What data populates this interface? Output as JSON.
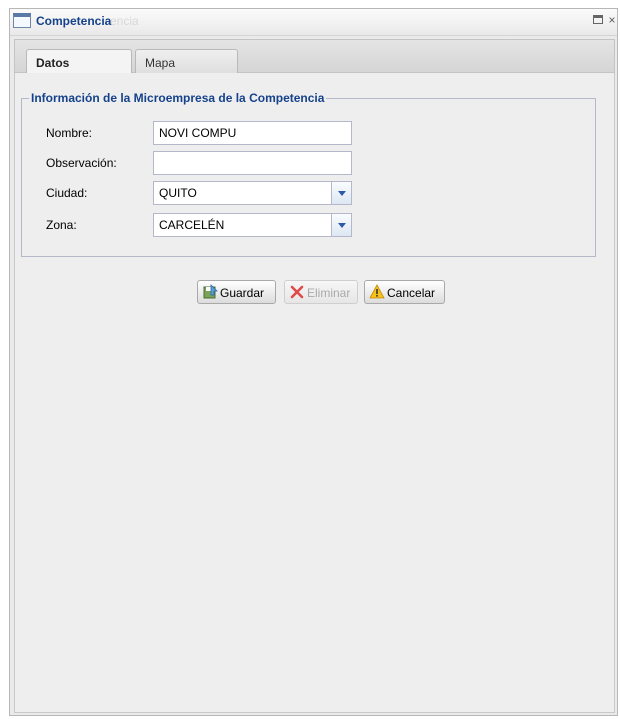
{
  "window": {
    "title": "Competencia",
    "ghost_text": "encia"
  },
  "tabs": [
    {
      "label": "Datos",
      "active": true
    },
    {
      "label": "Mapa",
      "active": false
    }
  ],
  "form": {
    "legend": "Información de la Microempresa de la Competencia",
    "fields": [
      {
        "label": "Nombre:",
        "value": "NOVI COMPU",
        "type": "text"
      },
      {
        "label": "Observación:",
        "value": "",
        "type": "text"
      },
      {
        "label": "Ciudad:",
        "value": "QUITO",
        "type": "combo"
      },
      {
        "label": "Zona:",
        "value": "CARCELÉN",
        "type": "combo"
      }
    ]
  },
  "buttons": {
    "guardar": "Guardar",
    "eliminar": "Eliminar",
    "cancelar": "Cancelar"
  },
  "icons": {
    "window": "window-icon",
    "maximize": "maximize-icon",
    "close": "close-icon",
    "save": "save-icon",
    "delete": "delete-icon",
    "cancel": "warning-icon"
  },
  "colors": {
    "title_blue": "#15428b",
    "panel_bg": "#eeeeee",
    "combo_arrow": "#2a5aa8"
  }
}
